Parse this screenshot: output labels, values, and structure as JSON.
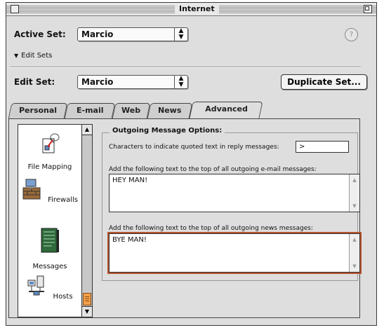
{
  "window": {
    "title": "Internet"
  },
  "active_set": {
    "label": "Active Set:",
    "value": "Marcio"
  },
  "edit_sets_disclosure": {
    "label": "Edit Sets"
  },
  "edit_set": {
    "label": "Edit Set:",
    "value": "Marcio"
  },
  "duplicate_button": {
    "label": "Duplicate Set..."
  },
  "tabs": [
    "Personal",
    "E-mail",
    "Web",
    "News",
    "Advanced"
  ],
  "active_tab": "Advanced",
  "sidebar": {
    "items": [
      {
        "label": "File Mapping",
        "icon": "file-mapping-icon",
        "selected": false
      },
      {
        "label": "Firewalls",
        "icon": "firewalls-icon",
        "selected": false
      },
      {
        "label": "Messages",
        "icon": "messages-icon",
        "selected": true
      },
      {
        "label": "Hosts",
        "icon": "hosts-icon",
        "selected": false
      }
    ]
  },
  "outgoing": {
    "group_title": "Outgoing Message Options:",
    "quote_label": "Characters to indicate quoted text in reply messages:",
    "quote_value": ">",
    "email_label": "Add the following text to the top of all outgoing e-mail messages:",
    "email_text": "HEY MAN!",
    "news_label": "Add the following text to the top of all outgoing news messages:",
    "news_text": "BYE MAN!"
  },
  "colors": {
    "focus_ring": "#b5522c",
    "scroll_thumb": "#f2a04a",
    "selection": "#111111"
  }
}
